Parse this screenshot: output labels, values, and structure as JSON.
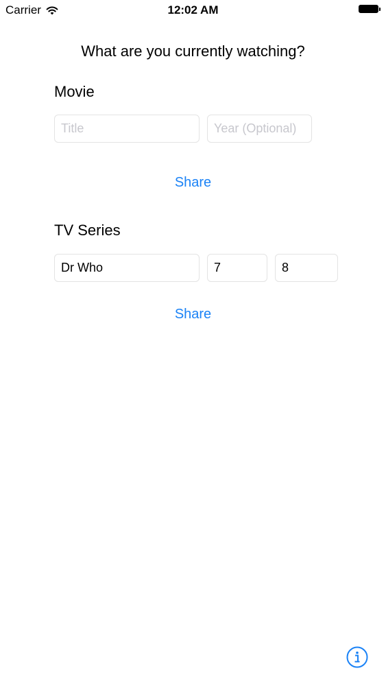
{
  "status_bar": {
    "carrier": "Carrier",
    "time": "12:02 AM",
    "wifi_icon": "wifi-icon",
    "battery_icon": "battery-icon"
  },
  "page": {
    "title": "What are you currently watching?"
  },
  "movie": {
    "label": "Movie",
    "title_field": {
      "value": "",
      "placeholder": "Title"
    },
    "year_field": {
      "value": "",
      "placeholder": "Year (Optional)"
    },
    "share_label": "Share"
  },
  "tv_series": {
    "label": "TV Series",
    "title_field": {
      "value": "Dr Who"
    },
    "season_field": {
      "value": "7"
    },
    "episode_field": {
      "value": "8"
    },
    "share_label": "Share"
  },
  "info_button": {
    "icon": "info-icon"
  },
  "colors": {
    "accent": "#1a82f6",
    "placeholder": "#c7c7cd",
    "field_border": "#e3e3e3"
  }
}
